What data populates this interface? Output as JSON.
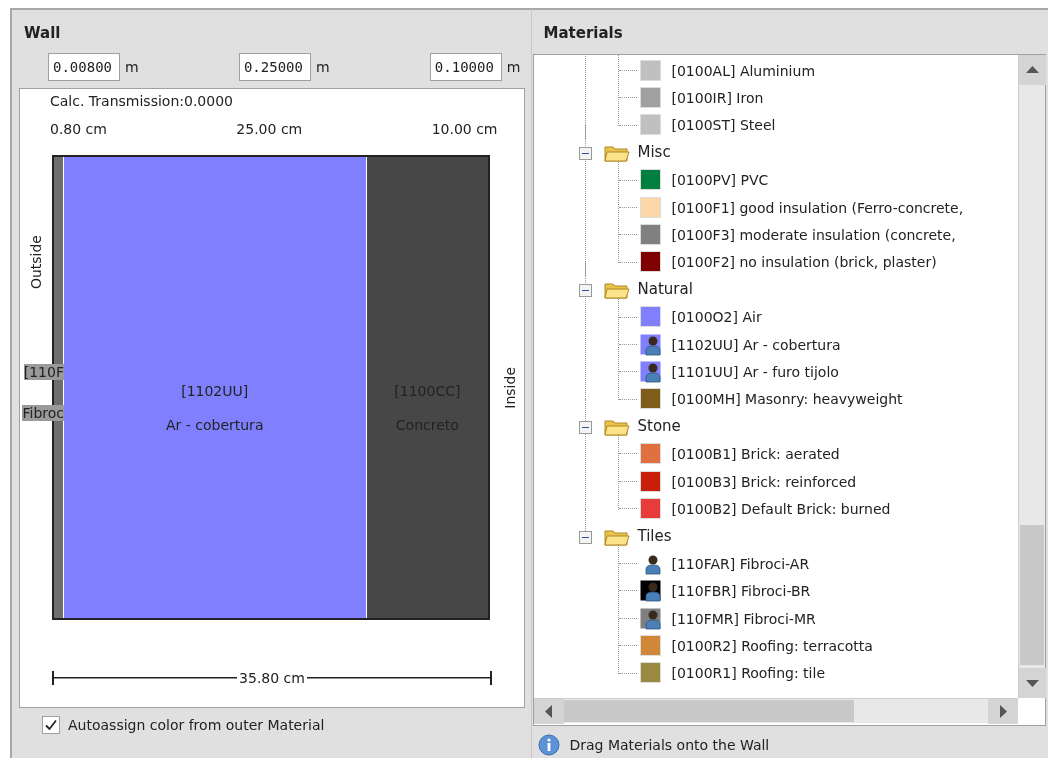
{
  "wall": {
    "title": "Wall",
    "layers": [
      {
        "thickness": "0.00800",
        "unit": "m",
        "thickness_label": "0.80 cm",
        "code": "[110F",
        "name": "Fibroc",
        "color": "#6e6e6e"
      },
      {
        "thickness": "0.25000",
        "unit": "m",
        "thickness_label": "25.00 cm",
        "code": "[1102UU]",
        "name": "Ar - cobertura",
        "color": "#8080ff"
      },
      {
        "thickness": "0.10000",
        "unit": "m",
        "thickness_label": "10.00 cm",
        "code": "[1100CC]",
        "name": "Concreto",
        "color": "#474747"
      }
    ],
    "transmission": "Calc.  Transmission:0.0000",
    "outside_label": "Outside",
    "inside_label": "Inside",
    "total": "35.80 cm",
    "autoassign": {
      "label": "Autoassign color from outer Material",
      "checked": true
    }
  },
  "materials": {
    "title": "Materials",
    "groups": [
      {
        "children": [
          {
            "kind": "swatch",
            "label": "[0100AL] Aluminium",
            "color": "#c0c0c0"
          },
          {
            "kind": "swatch",
            "label": "[0100IR] Iron",
            "color": "#a0a0a0"
          },
          {
            "kind": "swatch",
            "label": "[0100ST] Steel",
            "color": "#c0c0c0"
          }
        ]
      },
      {
        "label": "Misc",
        "expanded": true,
        "children": [
          {
            "kind": "swatch",
            "label": "[0100PV] PVC",
            "color": "#007f3f"
          },
          {
            "kind": "swatch",
            "label": "[0100F1] good insulation (Ferro-concrete,",
            "color": "#fcd8a8"
          },
          {
            "kind": "swatch",
            "label": "[0100F3] moderate insulation (concrete,",
            "color": "#808080"
          },
          {
            "kind": "swatch",
            "label": "[0100F2] no insulation (brick, plaster)",
            "color": "#7f0000"
          }
        ]
      },
      {
        "label": "Natural",
        "expanded": true,
        "children": [
          {
            "kind": "swatch",
            "label": "[0100O2] Air",
            "color": "#8080ff"
          },
          {
            "kind": "user",
            "label": "[1102UU] Ar - cobertura",
            "color": "#8080ff"
          },
          {
            "kind": "user",
            "label": "[1101UU] Ar - furo tijolo",
            "color": "#8080ff"
          },
          {
            "kind": "swatch",
            "label": "[0100MH] Masonry: heavyweight",
            "color": "#7f5c17"
          }
        ]
      },
      {
        "label": "Stone",
        "expanded": true,
        "children": [
          {
            "kind": "swatch",
            "label": "[0100B1] Brick: aerated",
            "color": "#e07040"
          },
          {
            "kind": "swatch",
            "label": "[0100B3] Brick: reinforced",
            "color": "#c81e0a"
          },
          {
            "kind": "swatch",
            "label": "[0100B2] Default Brick: burned",
            "color": "#e83c3c"
          }
        ]
      },
      {
        "label": "Tiles",
        "expanded": true,
        "children": [
          {
            "kind": "user",
            "label": "[110FAR] Fibroci-AR"
          },
          {
            "kind": "user",
            "label": "[110FBR] Fibroci-BR",
            "color": "#000000"
          },
          {
            "kind": "user",
            "label": "[110FMR] Fibroci-MR",
            "color": "#808080"
          },
          {
            "kind": "swatch",
            "label": "[0100R2] Roofing: terracotta",
            "color": "#d08838"
          },
          {
            "kind": "swatch",
            "label": "[0100R1] Roofing: tile",
            "color": "#9a8a40"
          }
        ]
      }
    ],
    "hint": "Drag Materials onto the Wall"
  }
}
